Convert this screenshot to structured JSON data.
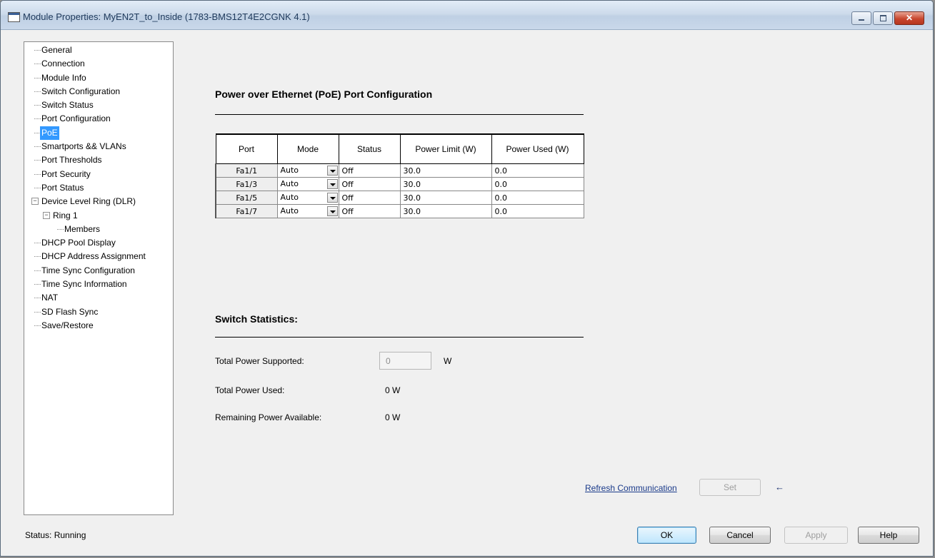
{
  "window": {
    "title": "Module Properties: MyEN2T_to_Inside (1783-BMS12T4E2CGNK 4.1)",
    "close_glyph": "✕"
  },
  "tree": {
    "items": [
      {
        "label": "General",
        "level": 0
      },
      {
        "label": "Connection",
        "level": 0
      },
      {
        "label": "Module Info",
        "level": 0
      },
      {
        "label": "Switch Configuration",
        "level": 0
      },
      {
        "label": "Switch Status",
        "level": 0
      },
      {
        "label": "Port Configuration",
        "level": 0
      },
      {
        "label": "PoE",
        "level": 0,
        "selected": true
      },
      {
        "label": "Smartports && VLANs",
        "level": 0
      },
      {
        "label": "Port Thresholds",
        "level": 0
      },
      {
        "label": "Port Security",
        "level": 0
      },
      {
        "label": "Port Status",
        "level": 0
      },
      {
        "label": "Device Level Ring (DLR)",
        "level": 0,
        "expander": "−"
      },
      {
        "label": "Ring 1",
        "level": 1,
        "expander": "−"
      },
      {
        "label": "Members",
        "level": 2
      },
      {
        "label": "DHCP Pool Display",
        "level": 0
      },
      {
        "label": "DHCP Address Assignment",
        "level": 0
      },
      {
        "label": "Time Sync Configuration",
        "level": 0
      },
      {
        "label": "Time Sync Information",
        "level": 0
      },
      {
        "label": "NAT",
        "level": 0
      },
      {
        "label": "SD Flash Sync",
        "level": 0
      },
      {
        "label": "Save/Restore",
        "level": 0
      }
    ]
  },
  "poe": {
    "title": "Power over Ethernet (PoE) Port Configuration",
    "columns": [
      "Port",
      "Mode",
      "Status",
      "Power Limit (W)",
      "Power Used (W)"
    ],
    "rows": [
      {
        "port": "Fa1/1",
        "mode": "Auto",
        "status": "Off",
        "limit": "30.0",
        "used": "0.0"
      },
      {
        "port": "Fa1/3",
        "mode": "Auto",
        "status": "Off",
        "limit": "30.0",
        "used": "0.0"
      },
      {
        "port": "Fa1/5",
        "mode": "Auto",
        "status": "Off",
        "limit": "30.0",
        "used": "0.0"
      },
      {
        "port": "Fa1/7",
        "mode": "Auto",
        "status": "Off",
        "limit": "30.0",
        "used": "0.0"
      }
    ]
  },
  "stats": {
    "title": "Switch Statistics:",
    "total_supported_label": "Total Power Supported:",
    "total_supported_value": "0",
    "total_supported_unit": "W",
    "total_used_label": "Total Power Used:",
    "total_used_value": "0 W",
    "remaining_label": "Remaining Power Available:",
    "remaining_value": "0 W"
  },
  "actions": {
    "refresh_link": "Refresh Communication",
    "set_label": "Set",
    "arrow_glyph": "←"
  },
  "footer": {
    "status": "Status:  Running",
    "ok": "OK",
    "cancel": "Cancel",
    "apply": "Apply",
    "help": "Help"
  }
}
